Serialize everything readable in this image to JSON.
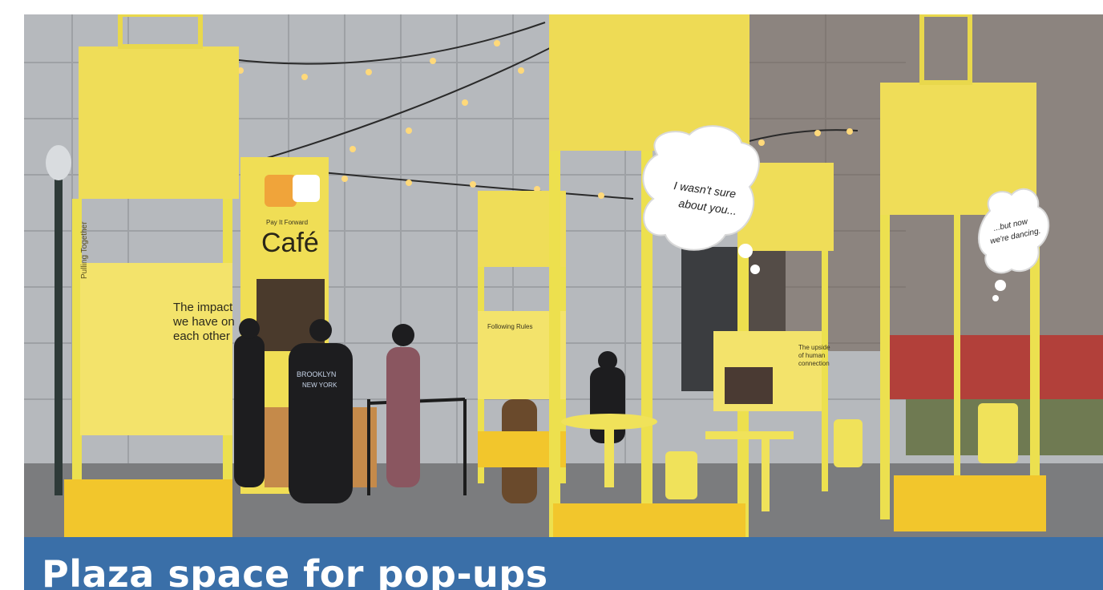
{
  "photo": {
    "cafe_sign": {
      "tagline": "Pay It Forward",
      "name": "Café"
    },
    "panel_left": {
      "header": "Pulling Together",
      "heading_line1": "The impact",
      "heading_line2": "we have on",
      "heading_line3": "each other"
    },
    "panel_middle": {
      "header": "Following Rules"
    },
    "panel_right": {
      "heading_line1": "The upside",
      "heading_line2": "of human",
      "heading_line3": "connection"
    },
    "bubble_left": {
      "line1": "I wasn't sure",
      "line2": "about you..."
    },
    "bubble_right": {
      "line1": "...but now",
      "line2": "we're dancing."
    },
    "sweatshirt_text_line1": "BROOKLYN",
    "sweatshirt_text_line2": "NEW YORK"
  },
  "banner": {
    "title": "Plaza space for pop-ups"
  },
  "colors": {
    "banner_blue": "#3a6fa8",
    "structure_yellow": "#f0e25a",
    "panel_yellow": "#f3e36b",
    "box_orange_yellow": "#f2c62c",
    "building_gray": "#b4b7bb",
    "ground_gray": "#7b7c7e"
  }
}
